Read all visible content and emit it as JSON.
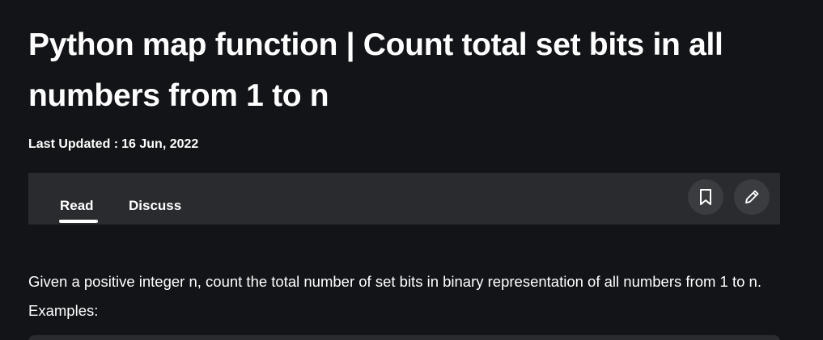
{
  "article": {
    "title": "Python map function | Count total set bits in all numbers from 1 to n",
    "updated_label": "Last Updated :",
    "updated_date": "16 Jun, 2022",
    "intro": "Given a positive integer n, count the total number of set bits in binary representation of all numbers from 1 to n. Examples:"
  },
  "tabs": [
    {
      "label": "Read",
      "active": true
    },
    {
      "label": "Discuss",
      "active": false
    }
  ],
  "actions": {
    "bookmark_icon": "bookmark-icon",
    "edit_icon": "pencil-icon"
  },
  "colors": {
    "background": "#131417",
    "tabbar": "#2a2b2e",
    "icon_button": "#3b3c3f",
    "text": "#ffffff"
  }
}
